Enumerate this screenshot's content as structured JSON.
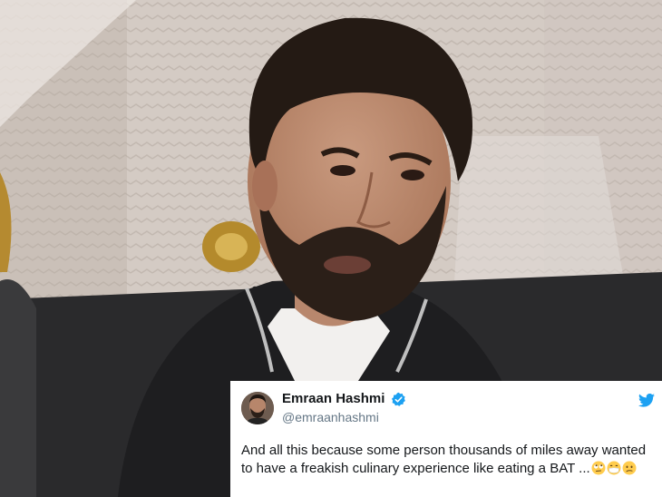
{
  "tweet": {
    "display_name": "Emraan Hashmi",
    "handle": "@emraanhashmi",
    "text": "And all this because some person thousands of miles away wanted to have a freakish culinary experience like eating a BAT ...",
    "emojis": [
      "face-with-rolling-eyes",
      "face-with-medical-mask",
      "confused-face"
    ],
    "verified": true,
    "colors": {
      "verified_blue": "#1da1f2",
      "twitter_blue": "#1da1f2",
      "text": "#14171a",
      "handle": "#657786"
    }
  },
  "photo": {
    "subject": "man-with-beard-portrait",
    "colors": {
      "wall": "#d3cac3",
      "jacket": "#1c1c1e",
      "hair": "#241a14",
      "skin": "#b98a70"
    }
  }
}
